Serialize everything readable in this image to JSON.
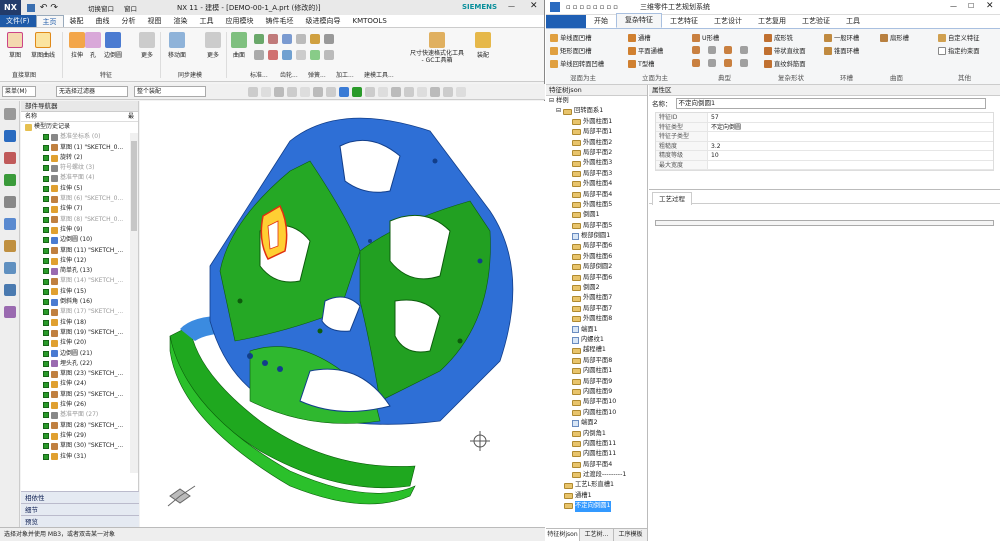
{
  "nx": {
    "logo": "NX",
    "title": "NX 11 - 建模 - [DEMO-00-1_A.prt  (修改的)]",
    "brand": "SIEMENS",
    "window_menu": "窗口",
    "switch_window": "切换窗口",
    "menu": [
      "文件(F)",
      "主页",
      "装配",
      "曲线",
      "分析",
      "视图",
      "渲染",
      "工具",
      "应用模块",
      "铸件毛坯",
      "级进模向导",
      "KMTOOLS"
    ],
    "active_menu": "主页",
    "ribbon_buttons": [
      "草图",
      "草图曲线",
      "拉伸",
      "孔",
      "边倒圆",
      "更多",
      "移动面",
      "更多",
      "曲面",
      "尺寸快速格式化工具 - GC工具箱",
      "装配"
    ],
    "ribbon_groups": [
      "直接草图",
      "特征",
      "同步建模",
      "标准...",
      "齿轮...",
      "弹簧...",
      "加工...",
      "建模工具..."
    ],
    "menu_dropdown": "菜单(M)",
    "filter": "无选择过滤器",
    "scope": "整个装配",
    "nav_title": "部件导航器",
    "nav_col_name": "名称",
    "nav_col_latest": "最",
    "nav_root": "模型历史记录",
    "nav_items": [
      {
        "t": "基准坐标系 (0)",
        "g": true
      },
      {
        "t": "草图 (1) \"SKETCH_0...",
        "g": false
      },
      {
        "t": "旋转 (2)",
        "g": false
      },
      {
        "t": "符号螺纹 (3)",
        "g": true
      },
      {
        "t": "基准平面 (4)",
        "g": true
      },
      {
        "t": "拉伸 (5)",
        "g": false
      },
      {
        "t": "草图 (6) \"SKETCH_0...",
        "g": true
      },
      {
        "t": "拉伸 (7)",
        "g": false
      },
      {
        "t": "草图 (8) \"SKETCH_0...",
        "g": true
      },
      {
        "t": "拉伸 (9)",
        "g": false
      },
      {
        "t": "边倒圆 (10)",
        "g": false
      },
      {
        "t": "草图 (11) \"SKETCH_...",
        "g": false
      },
      {
        "t": "拉伸 (12)",
        "g": false
      },
      {
        "t": "简单孔 (13)",
        "g": false
      },
      {
        "t": "草图 (14) \"SKETCH_...",
        "g": true
      },
      {
        "t": "拉伸 (15)",
        "g": false
      },
      {
        "t": "倒斜角 (16)",
        "g": false
      },
      {
        "t": "草图 (17) \"SKETCH_...",
        "g": true
      },
      {
        "t": "拉伸 (18)",
        "g": false
      },
      {
        "t": "草图 (19) \"SKETCH_...",
        "g": false
      },
      {
        "t": "拉伸 (20)",
        "g": false
      },
      {
        "t": "边倒圆 (21)",
        "g": false
      },
      {
        "t": "埋头孔 (22)",
        "g": false
      },
      {
        "t": "草图 (23) \"SKETCH_...",
        "g": false
      },
      {
        "t": "拉伸 (24)",
        "g": false
      },
      {
        "t": "草图 (25) \"SKETCH_...",
        "g": false
      },
      {
        "t": "拉伸 (26)",
        "g": false
      },
      {
        "t": "基准平面 (27)",
        "g": true
      },
      {
        "t": "草图 (28) \"SKETCH_...",
        "g": false
      },
      {
        "t": "拉伸 (29)",
        "g": false
      },
      {
        "t": "草图 (30) \"SKETCH_...",
        "g": false
      },
      {
        "t": "拉伸 (31)",
        "g": false
      }
    ],
    "panels": [
      "相依性",
      "细节",
      "预览"
    ],
    "status": "选择对象并使用 MB3，或者双击某一对象"
  },
  "app": {
    "title": "三维零件工艺规划系统",
    "tabs": [
      "开始",
      "复杂特征",
      "工艺特征",
      "工艺设计",
      "工艺复用",
      "工艺验证",
      "工具"
    ],
    "active_tab": "复杂特征",
    "ribbon": {
      "g1": [
        "单线面凹槽",
        "矩形面凹槽",
        "单线回转面凹槽"
      ],
      "g2": [
        "通槽",
        "平面通槽",
        "T型槽"
      ],
      "g3": [
        "U形槽"
      ],
      "g4": [
        "成形铣",
        "带状直纹面",
        "直纹斜筋面"
      ],
      "g5": [
        "一般环槽",
        "锥面环槽"
      ],
      "g6": [
        "扇形槽"
      ],
      "g7": [
        "自定义特征",
        "指定约束面"
      ]
    },
    "groups": [
      "混面为主",
      "立面为主",
      "典型",
      "复杂形状",
      "环槽",
      "曲面",
      "其他"
    ],
    "tree_title": "特征树json",
    "tree_root": "样例",
    "tree_sub": "回转面系1",
    "tree_items": [
      "外圆柱面1",
      "局部平面1",
      "外圆柱面2",
      "局部平面2",
      "外圆柱面3",
      "局部平面3",
      "外圆柱面4",
      "局部平面4",
      "外圆柱面5",
      "倒圆1",
      "局部平面5",
      "根部倒圆1",
      "局部平面6",
      "外圆柱面6",
      "局部倒圆2",
      "局部平面6",
      "倒圆2",
      "外圆柱面7",
      "局部平面7",
      "外圆柱面8",
      "端面1",
      "内螺纹1",
      "越程槽1",
      "局部平面8",
      "内圆柱面1",
      "局部平面9",
      "内圆柱面9",
      "局部平面10",
      "内圆柱面10",
      "端面2",
      "内倒角1",
      "内圆柱面11",
      "内圆柱面11",
      "局部平面4",
      "过渡段---------1"
    ],
    "tree_tail": [
      "工艺L形直槽1",
      "通槽1",
      "不定向倒圆1"
    ],
    "bottom_tabs": [
      "特征树json",
      "工艺树...",
      "工序模板"
    ],
    "prop_title": "属性区",
    "prop_name_label": "名称：",
    "prop_name": "不定向倒圆1",
    "props": [
      [
        "特征ID",
        "57"
      ],
      [
        "特征类型",
        "不定向倒圆"
      ],
      [
        "特征子类型",
        ""
      ],
      [
        "粗糙度",
        "3.2"
      ],
      [
        "精度等级",
        "10"
      ],
      [
        "最大宽度",
        ""
      ]
    ],
    "proc_tab": "工艺过程"
  }
}
